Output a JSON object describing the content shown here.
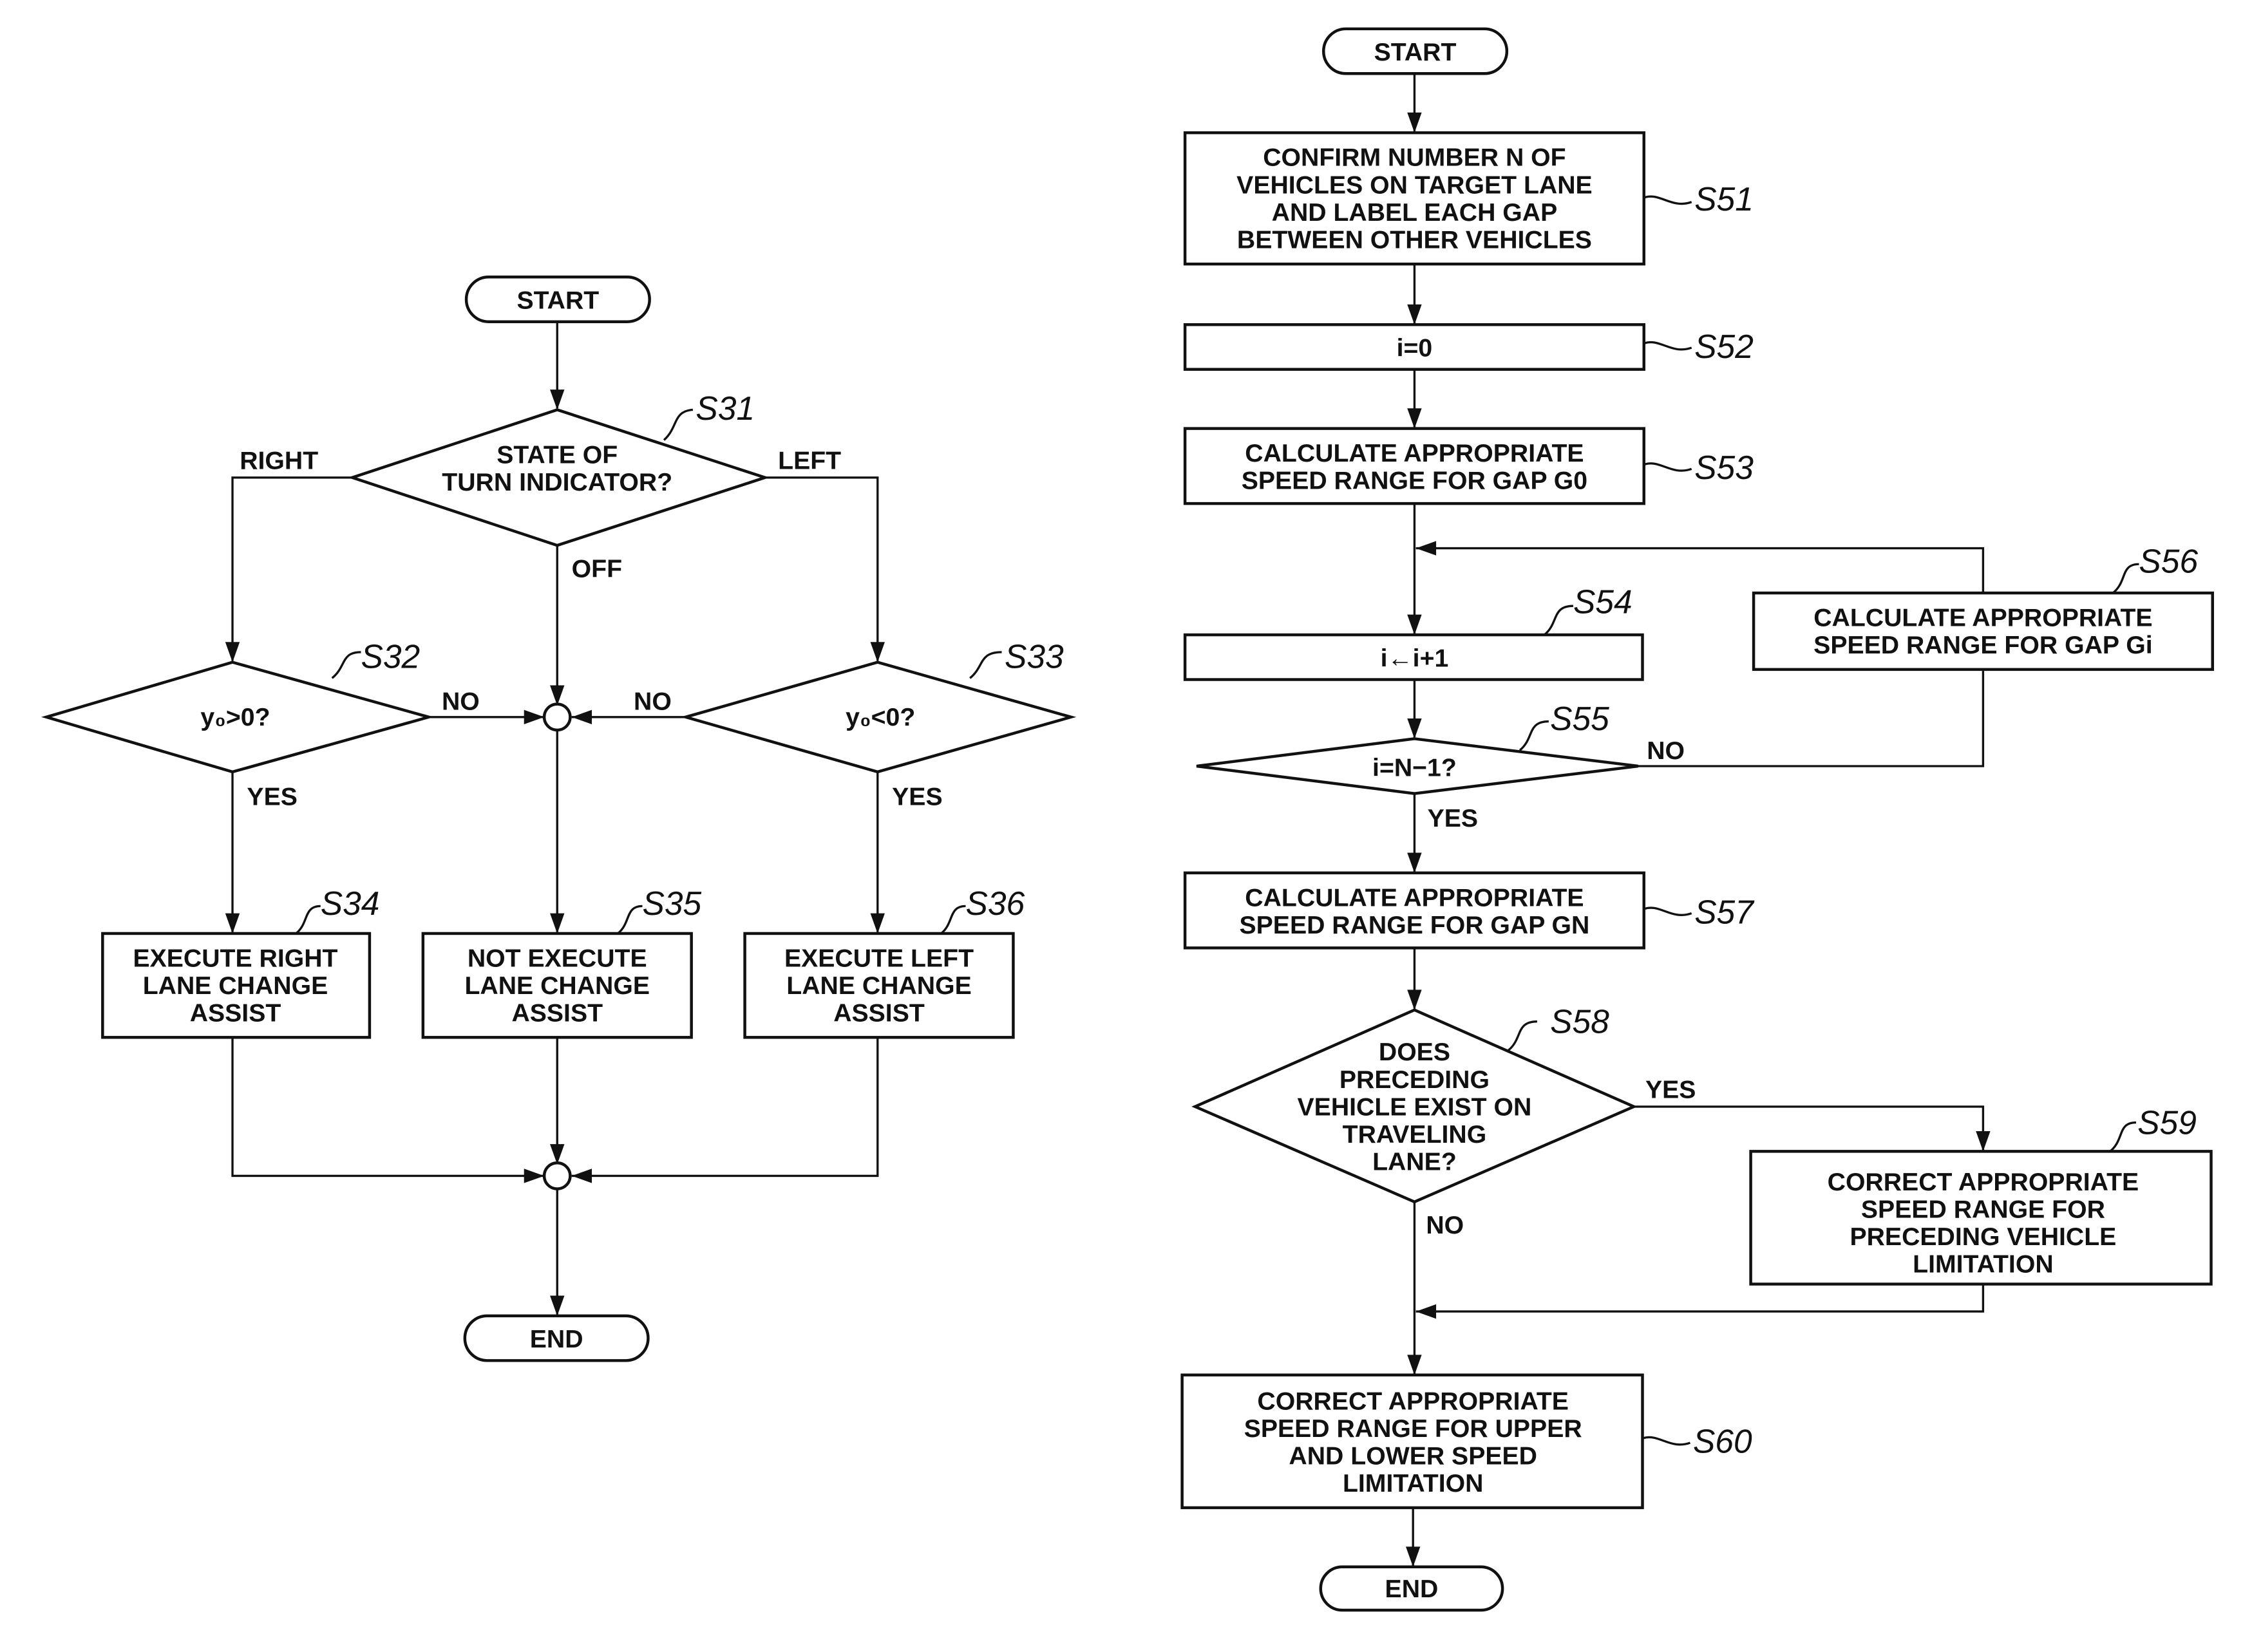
{
  "left_flowchart": {
    "start": "START",
    "end": "END",
    "s31": {
      "step": "S31",
      "lines": [
        "STATE OF",
        "TURN INDICATOR?"
      ],
      "branch_right": "RIGHT",
      "branch_left": "LEFT",
      "branch_off": "OFF"
    },
    "s32": {
      "step": "S32",
      "text": "y₀>0?",
      "no": "NO",
      "yes": "YES"
    },
    "s33": {
      "step": "S33",
      "text": "y₀<0?",
      "no": "NO",
      "yes": "YES"
    },
    "s34": {
      "step": "S34",
      "lines": [
        "EXECUTE RIGHT",
        "LANE CHANGE",
        "ASSIST"
      ]
    },
    "s35": {
      "step": "S35",
      "lines": [
        "NOT EXECUTE",
        "LANE CHANGE",
        "ASSIST"
      ]
    },
    "s36": {
      "step": "S36",
      "lines": [
        "EXECUTE LEFT",
        "LANE CHANGE",
        "ASSIST"
      ]
    }
  },
  "right_flowchart": {
    "start": "START",
    "end": "END",
    "s51": {
      "step": "S51",
      "lines": [
        "CONFIRM NUMBER N OF",
        "VEHICLES ON TARGET LANE",
        "AND LABEL EACH GAP",
        "BETWEEN OTHER VEHICLES"
      ]
    },
    "s52": {
      "step": "S52",
      "text": "i=0"
    },
    "s53": {
      "step": "S53",
      "lines": [
        "CALCULATE APPROPRIATE",
        "SPEED RANGE FOR GAP G0"
      ]
    },
    "s54": {
      "step": "S54",
      "text": "i←i+1"
    },
    "s55": {
      "step": "S55",
      "text": "i=N−1?",
      "no": "NO",
      "yes": "YES"
    },
    "s56": {
      "step": "S56",
      "lines": [
        "CALCULATE APPROPRIATE",
        "SPEED RANGE FOR GAP Gi"
      ]
    },
    "s57": {
      "step": "S57",
      "lines": [
        "CALCULATE APPROPRIATE",
        "SPEED RANGE FOR GAP GN"
      ]
    },
    "s58": {
      "step": "S58",
      "lines": [
        "DOES",
        "PRECEDING",
        "VEHICLE EXIST ON",
        "TRAVELING",
        "LANE?"
      ],
      "yes": "YES",
      "no": "NO"
    },
    "s59": {
      "step": "S59",
      "lines": [
        "CORRECT APPROPRIATE",
        "SPEED RANGE FOR",
        "PRECEDING VEHICLE",
        "LIMITATION"
      ]
    },
    "s60": {
      "step": "S60",
      "lines": [
        "CORRECT APPROPRIATE",
        "SPEED RANGE FOR UPPER",
        "AND LOWER SPEED",
        "LIMITATION"
      ]
    }
  }
}
